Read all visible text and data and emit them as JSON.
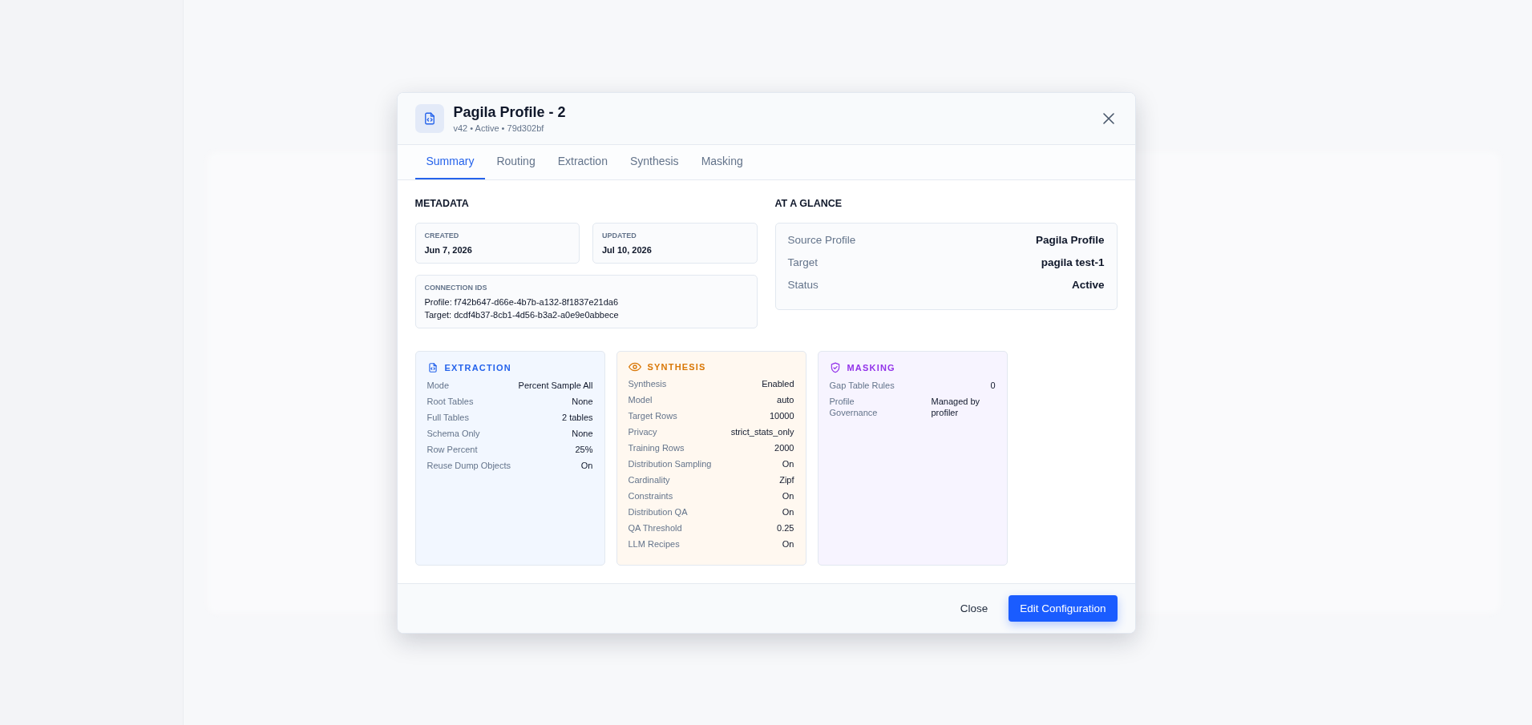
{
  "modal": {
    "title": "Pagila Profile - 2",
    "subtitle": "v42 • Active • 79d302bf",
    "tabs": [
      {
        "label": "Summary",
        "selected": true
      },
      {
        "label": "Routing",
        "selected": false
      },
      {
        "label": "Extraction",
        "selected": false
      },
      {
        "label": "Synthesis",
        "selected": false
      },
      {
        "label": "Masking",
        "selected": false
      }
    ],
    "metadata": {
      "heading": "METADATA",
      "dates": [
        {
          "label": "CREATED",
          "value": "Jun 7, 2026"
        },
        {
          "label": "UPDATED",
          "value": "Jul 10, 2026"
        }
      ],
      "connection": {
        "label": "CONNECTION IDS",
        "lines": [
          "Profile: f742b647-d66e-4b7b-a132-8f1837e21da6",
          "Target: dcdf4b37-8cb1-4d56-b3a2-a0e9e0abbece"
        ]
      }
    },
    "glance": {
      "heading": "AT A GLANCE",
      "rows": [
        {
          "label": "Source Profile",
          "value": "Pagila Profile"
        },
        {
          "label": "Target",
          "value": "pagila test-1"
        },
        {
          "label": "Status",
          "value": "Active"
        }
      ]
    },
    "sections": [
      {
        "kind": "extraction",
        "title": "EXTRACTION",
        "rows": [
          {
            "label": "Mode",
            "value": "Percent Sample All"
          },
          {
            "label": "Root Tables",
            "value": "None"
          },
          {
            "label": "Full Tables",
            "value": "2 tables"
          },
          {
            "label": "Schema Only",
            "value": "None"
          },
          {
            "label": "Row Percent",
            "value": "25%"
          },
          {
            "label": "Reuse Dump Objects",
            "value": "On"
          }
        ]
      },
      {
        "kind": "synthesis",
        "title": "SYNTHESIS",
        "rows": [
          {
            "label": "Synthesis",
            "value": "Enabled"
          },
          {
            "label": "Model",
            "value": "auto"
          },
          {
            "label": "Target Rows",
            "value": "10000"
          },
          {
            "label": "Privacy",
            "value": "strict_stats_only"
          },
          {
            "label": "Training Rows",
            "value": "2000"
          },
          {
            "label": "Distribution Sampling",
            "value": "On"
          },
          {
            "label": "Cardinality",
            "value": "Zipf"
          },
          {
            "label": "Constraints",
            "value": "On"
          },
          {
            "label": "Distribution QA",
            "value": "On"
          },
          {
            "label": "QA Threshold",
            "value": "0.25"
          },
          {
            "label": "LLM Recipes",
            "value": "On"
          }
        ]
      },
      {
        "kind": "masking",
        "title": "MASKING",
        "rows": [
          {
            "label": "Gap Table Rules",
            "value": "0"
          },
          {
            "label": "Profile Governance",
            "value": "Managed by profiler"
          }
        ]
      }
    ],
    "footer": {
      "close": "Close",
      "primary": "Edit Configuration"
    }
  }
}
